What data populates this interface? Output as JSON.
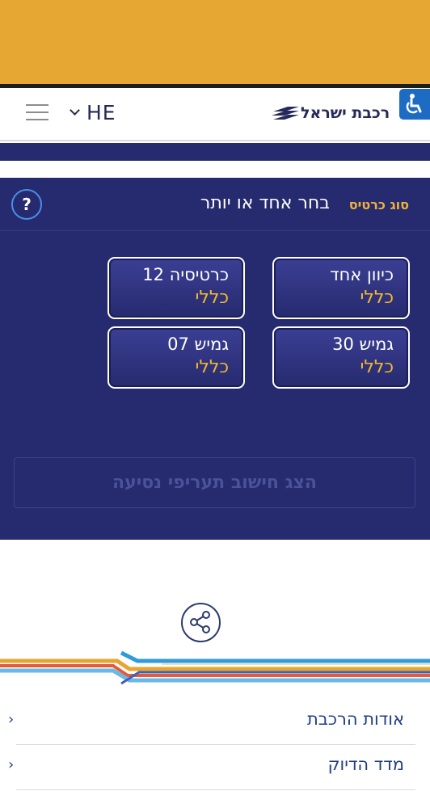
{
  "header": {
    "language": "HE",
    "logo_text": "רכבת ישראל"
  },
  "panel": {
    "ticket_type_label": "סוג כרטיס",
    "choose_label": "בחר אחד או יותר",
    "help_label": "?",
    "tickets": [
      {
        "name": "כיוון אחד",
        "kind": "כללי"
      },
      {
        "name": "כרטיסיה 12",
        "kind": "כללי"
      },
      {
        "name": "גמיש 30",
        "kind": "כללי"
      },
      {
        "name": "גמיש 07",
        "kind": "כללי"
      }
    ],
    "calc_button": "הצג חישוב תעריפי נסיעה"
  },
  "footer": {
    "items": [
      {
        "label": "אודות הרכבת"
      },
      {
        "label": "מדד הדיוק"
      }
    ]
  },
  "colors": {
    "top_band": "#e6a833",
    "navy": "#262a6e",
    "accent_yellow": "#f4b82e",
    "accessibility_blue": "#1e6bc4"
  },
  "icons": [
    "hamburger-icon",
    "chevron-down-icon",
    "accessibility-icon",
    "help-icon",
    "share-icon",
    "chevron-left-icon"
  ]
}
